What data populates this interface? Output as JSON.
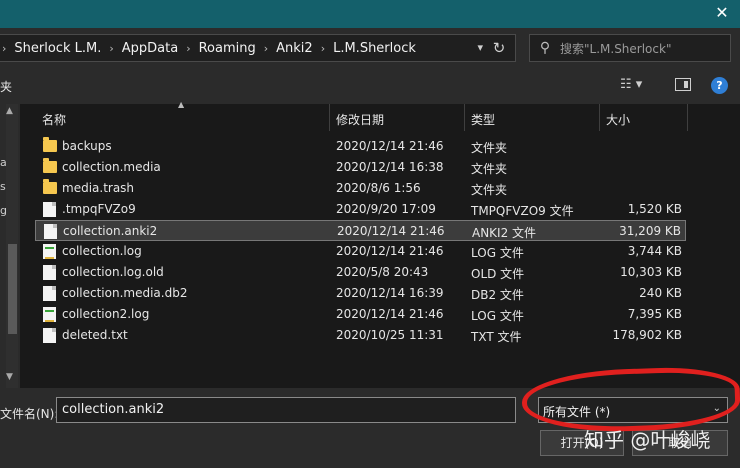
{
  "breadcrumb": [
    "Sherlock L.M.",
    "AppData",
    "Roaming",
    "Anki2",
    "L.M.Sherlock"
  ],
  "search": {
    "placeholder": "搜索\"L.M.Sherlock\""
  },
  "toolbar": {
    "left_text": "夹",
    "help": "?"
  },
  "nav_glyphs": [
    "a",
    "s",
    "g"
  ],
  "columns": {
    "name": "名称",
    "date": "修改日期",
    "type": "类型",
    "size": "大小"
  },
  "files": [
    {
      "name": "backups",
      "date": "2020/12/14 21:46",
      "type": "文件夹",
      "size": "",
      "icon": "folder"
    },
    {
      "name": "collection.media",
      "date": "2020/12/14 16:38",
      "type": "文件夹",
      "size": "",
      "icon": "folder"
    },
    {
      "name": "media.trash",
      "date": "2020/8/6 1:56",
      "type": "文件夹",
      "size": "",
      "icon": "folder"
    },
    {
      "name": ".tmpqFVZo9",
      "date": "2020/9/20 17:09",
      "type": "TMPQFVZO9 文件",
      "size": "1,520 KB",
      "icon": "doc"
    },
    {
      "name": "collection.anki2",
      "date": "2020/12/14 21:46",
      "type": "ANKI2 文件",
      "size": "31,209 KB",
      "icon": "doc",
      "selected": true
    },
    {
      "name": "collection.log",
      "date": "2020/12/14 21:46",
      "type": "LOG 文件",
      "size": "3,744 KB",
      "icon": "log"
    },
    {
      "name": "collection.log.old",
      "date": "2020/5/8 20:43",
      "type": "OLD 文件",
      "size": "10,303 KB",
      "icon": "doc"
    },
    {
      "name": "collection.media.db2",
      "date": "2020/12/14 16:39",
      "type": "DB2 文件",
      "size": "240 KB",
      "icon": "doc"
    },
    {
      "name": "collection2.log",
      "date": "2020/12/14 21:46",
      "type": "LOG 文件",
      "size": "7,395 KB",
      "icon": "log"
    },
    {
      "name": "deleted.txt",
      "date": "2020/10/25 11:31",
      "type": "TXT 文件",
      "size": "178,902 KB",
      "icon": "doc"
    }
  ],
  "filename": {
    "label": "文件名(N):",
    "value": "collection.anki2"
  },
  "filetype": {
    "selected": "所有文件 (*)"
  },
  "buttons": {
    "open": "打开(O)",
    "cancel": "取消"
  },
  "watermark": "知乎 @叶峻峣",
  "colors": {
    "titlebar": "#14606b",
    "highlight": "#e0201e",
    "folder": "#f5c74f"
  }
}
